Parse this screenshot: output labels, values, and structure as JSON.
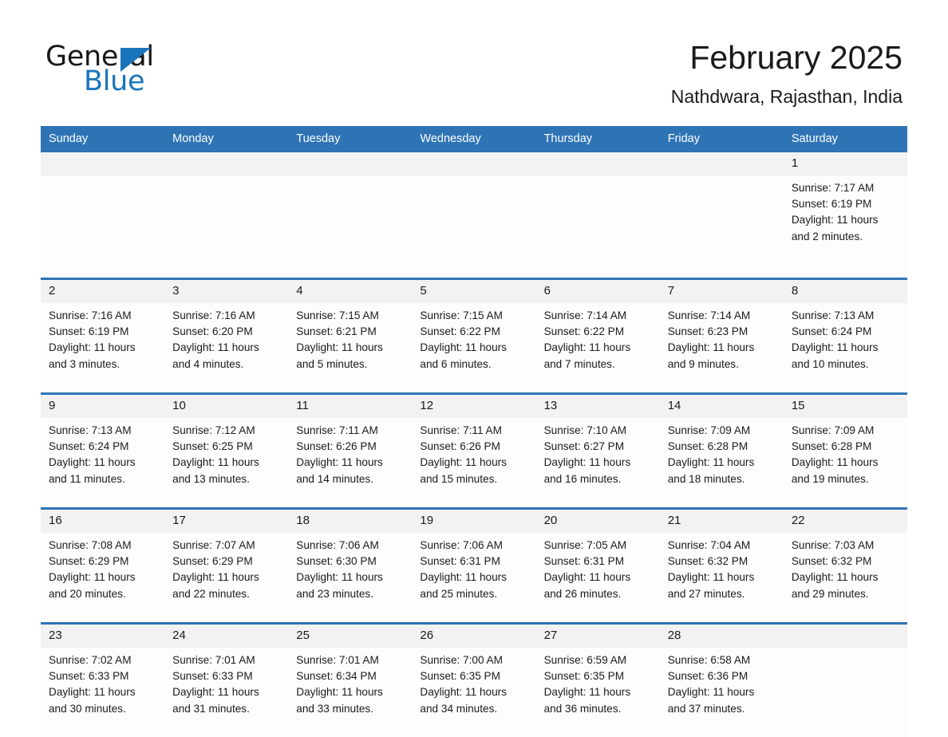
{
  "logo": {
    "word_dark": "General",
    "word_blue": "Blue",
    "triangle": "triangle-mark"
  },
  "header": {
    "title": "February 2025",
    "subtitle": "Nathdwara, Rajasthan, India"
  },
  "colors": {
    "accent_blue": "#2E74B5",
    "logo_blue": "#1975BB",
    "date_band": "#F2F2F2",
    "cell_bg": "#FDFDFD",
    "text": "#1A1A1A"
  },
  "weekdays": [
    "Sunday",
    "Monday",
    "Tuesday",
    "Wednesday",
    "Thursday",
    "Friday",
    "Saturday"
  ],
  "weeks": [
    [
      {
        "day": "",
        "sunrise": "",
        "sunset": "",
        "daylight1": "",
        "daylight2": ""
      },
      {
        "day": "",
        "sunrise": "",
        "sunset": "",
        "daylight1": "",
        "daylight2": ""
      },
      {
        "day": "",
        "sunrise": "",
        "sunset": "",
        "daylight1": "",
        "daylight2": ""
      },
      {
        "day": "",
        "sunrise": "",
        "sunset": "",
        "daylight1": "",
        "daylight2": ""
      },
      {
        "day": "",
        "sunrise": "",
        "sunset": "",
        "daylight1": "",
        "daylight2": ""
      },
      {
        "day": "",
        "sunrise": "",
        "sunset": "",
        "daylight1": "",
        "daylight2": ""
      },
      {
        "day": "1",
        "sunrise": "Sunrise: 7:17 AM",
        "sunset": "Sunset: 6:19 PM",
        "daylight1": "Daylight: 11 hours",
        "daylight2": "and 2 minutes."
      }
    ],
    [
      {
        "day": "2",
        "sunrise": "Sunrise: 7:16 AM",
        "sunset": "Sunset: 6:19 PM",
        "daylight1": "Daylight: 11 hours",
        "daylight2": "and 3 minutes."
      },
      {
        "day": "3",
        "sunrise": "Sunrise: 7:16 AM",
        "sunset": "Sunset: 6:20 PM",
        "daylight1": "Daylight: 11 hours",
        "daylight2": "and 4 minutes."
      },
      {
        "day": "4",
        "sunrise": "Sunrise: 7:15 AM",
        "sunset": "Sunset: 6:21 PM",
        "daylight1": "Daylight: 11 hours",
        "daylight2": "and 5 minutes."
      },
      {
        "day": "5",
        "sunrise": "Sunrise: 7:15 AM",
        "sunset": "Sunset: 6:22 PM",
        "daylight1": "Daylight: 11 hours",
        "daylight2": "and 6 minutes."
      },
      {
        "day": "6",
        "sunrise": "Sunrise: 7:14 AM",
        "sunset": "Sunset: 6:22 PM",
        "daylight1": "Daylight: 11 hours",
        "daylight2": "and 7 minutes."
      },
      {
        "day": "7",
        "sunrise": "Sunrise: 7:14 AM",
        "sunset": "Sunset: 6:23 PM",
        "daylight1": "Daylight: 11 hours",
        "daylight2": "and 9 minutes."
      },
      {
        "day": "8",
        "sunrise": "Sunrise: 7:13 AM",
        "sunset": "Sunset: 6:24 PM",
        "daylight1": "Daylight: 11 hours",
        "daylight2": "and 10 minutes."
      }
    ],
    [
      {
        "day": "9",
        "sunrise": "Sunrise: 7:13 AM",
        "sunset": "Sunset: 6:24 PM",
        "daylight1": "Daylight: 11 hours",
        "daylight2": "and 11 minutes."
      },
      {
        "day": "10",
        "sunrise": "Sunrise: 7:12 AM",
        "sunset": "Sunset: 6:25 PM",
        "daylight1": "Daylight: 11 hours",
        "daylight2": "and 13 minutes."
      },
      {
        "day": "11",
        "sunrise": "Sunrise: 7:11 AM",
        "sunset": "Sunset: 6:26 PM",
        "daylight1": "Daylight: 11 hours",
        "daylight2": "and 14 minutes."
      },
      {
        "day": "12",
        "sunrise": "Sunrise: 7:11 AM",
        "sunset": "Sunset: 6:26 PM",
        "daylight1": "Daylight: 11 hours",
        "daylight2": "and 15 minutes."
      },
      {
        "day": "13",
        "sunrise": "Sunrise: 7:10 AM",
        "sunset": "Sunset: 6:27 PM",
        "daylight1": "Daylight: 11 hours",
        "daylight2": "and 16 minutes."
      },
      {
        "day": "14",
        "sunrise": "Sunrise: 7:09 AM",
        "sunset": "Sunset: 6:28 PM",
        "daylight1": "Daylight: 11 hours",
        "daylight2": "and 18 minutes."
      },
      {
        "day": "15",
        "sunrise": "Sunrise: 7:09 AM",
        "sunset": "Sunset: 6:28 PM",
        "daylight1": "Daylight: 11 hours",
        "daylight2": "and 19 minutes."
      }
    ],
    [
      {
        "day": "16",
        "sunrise": "Sunrise: 7:08 AM",
        "sunset": "Sunset: 6:29 PM",
        "daylight1": "Daylight: 11 hours",
        "daylight2": "and 20 minutes."
      },
      {
        "day": "17",
        "sunrise": "Sunrise: 7:07 AM",
        "sunset": "Sunset: 6:29 PM",
        "daylight1": "Daylight: 11 hours",
        "daylight2": "and 22 minutes."
      },
      {
        "day": "18",
        "sunrise": "Sunrise: 7:06 AM",
        "sunset": "Sunset: 6:30 PM",
        "daylight1": "Daylight: 11 hours",
        "daylight2": "and 23 minutes."
      },
      {
        "day": "19",
        "sunrise": "Sunrise: 7:06 AM",
        "sunset": "Sunset: 6:31 PM",
        "daylight1": "Daylight: 11 hours",
        "daylight2": "and 25 minutes."
      },
      {
        "day": "20",
        "sunrise": "Sunrise: 7:05 AM",
        "sunset": "Sunset: 6:31 PM",
        "daylight1": "Daylight: 11 hours",
        "daylight2": "and 26 minutes."
      },
      {
        "day": "21",
        "sunrise": "Sunrise: 7:04 AM",
        "sunset": "Sunset: 6:32 PM",
        "daylight1": "Daylight: 11 hours",
        "daylight2": "and 27 minutes."
      },
      {
        "day": "22",
        "sunrise": "Sunrise: 7:03 AM",
        "sunset": "Sunset: 6:32 PM",
        "daylight1": "Daylight: 11 hours",
        "daylight2": "and 29 minutes."
      }
    ],
    [
      {
        "day": "23",
        "sunrise": "Sunrise: 7:02 AM",
        "sunset": "Sunset: 6:33 PM",
        "daylight1": "Daylight: 11 hours",
        "daylight2": "and 30 minutes."
      },
      {
        "day": "24",
        "sunrise": "Sunrise: 7:01 AM",
        "sunset": "Sunset: 6:33 PM",
        "daylight1": "Daylight: 11 hours",
        "daylight2": "and 31 minutes."
      },
      {
        "day": "25",
        "sunrise": "Sunrise: 7:01 AM",
        "sunset": "Sunset: 6:34 PM",
        "daylight1": "Daylight: 11 hours",
        "daylight2": "and 33 minutes."
      },
      {
        "day": "26",
        "sunrise": "Sunrise: 7:00 AM",
        "sunset": "Sunset: 6:35 PM",
        "daylight1": "Daylight: 11 hours",
        "daylight2": "and 34 minutes."
      },
      {
        "day": "27",
        "sunrise": "Sunrise: 6:59 AM",
        "sunset": "Sunset: 6:35 PM",
        "daylight1": "Daylight: 11 hours",
        "daylight2": "and 36 minutes."
      },
      {
        "day": "28",
        "sunrise": "Sunrise: 6:58 AM",
        "sunset": "Sunset: 6:36 PM",
        "daylight1": "Daylight: 11 hours",
        "daylight2": "and 37 minutes."
      },
      {
        "day": "",
        "sunrise": "",
        "sunset": "",
        "daylight1": "",
        "daylight2": ""
      }
    ]
  ]
}
